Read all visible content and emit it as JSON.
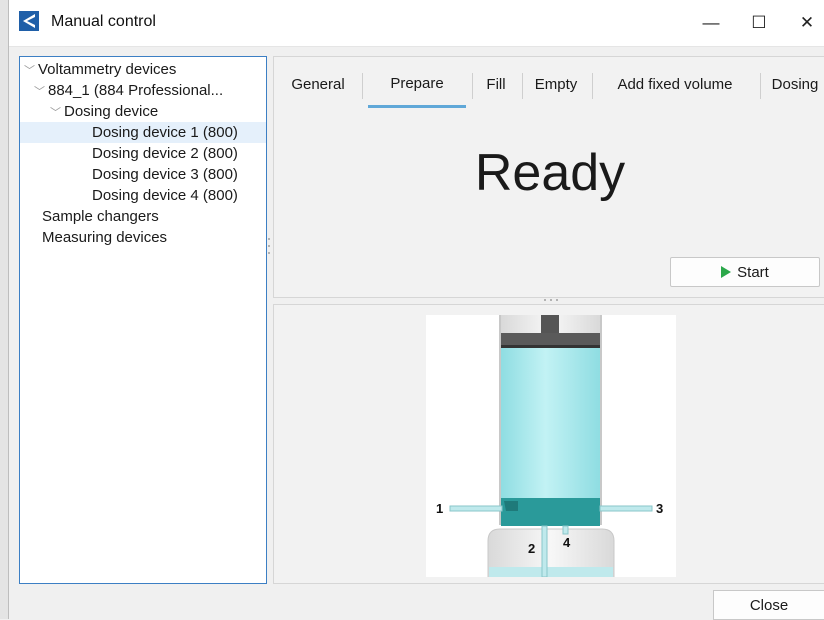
{
  "window": {
    "title": "Manual control",
    "minimize_symbol": "—",
    "maximize_symbol": "☐",
    "close_symbol": "✕"
  },
  "tree": {
    "items": [
      {
        "label": "Voltammetry devices",
        "expanded": true
      },
      {
        "label": "884_1 (884 Professional...",
        "expanded": true
      },
      {
        "label": "Dosing device",
        "expanded": true
      },
      {
        "label": "Dosing device 1 (800)",
        "selected": true
      },
      {
        "label": "Dosing device 2 (800)"
      },
      {
        "label": "Dosing device 3 (800)"
      },
      {
        "label": "Dosing device 4 (800)"
      },
      {
        "label": "Sample changers"
      },
      {
        "label": "Measuring devices"
      }
    ]
  },
  "tabs": [
    {
      "label": "General"
    },
    {
      "label": "Prepare",
      "active": true
    },
    {
      "label": "Fill"
    },
    {
      "label": "Empty"
    },
    {
      "label": "Add fixed volume"
    },
    {
      "label": "Dosing"
    }
  ],
  "status": {
    "text": "Ready"
  },
  "start_button": {
    "label": "Start"
  },
  "diagram": {
    "labels": {
      "port1": "1",
      "port2": "2",
      "port3": "3",
      "port4": "4"
    },
    "colors": {
      "liquid": "#a8e6ea",
      "valve": "#2a9a9a",
      "piston": "#555555"
    }
  },
  "footer": {
    "close_label": "Close"
  },
  "icons": {
    "app": "metrohm-logo-icon",
    "expand": "chevron-down-icon",
    "play": "play-icon"
  }
}
